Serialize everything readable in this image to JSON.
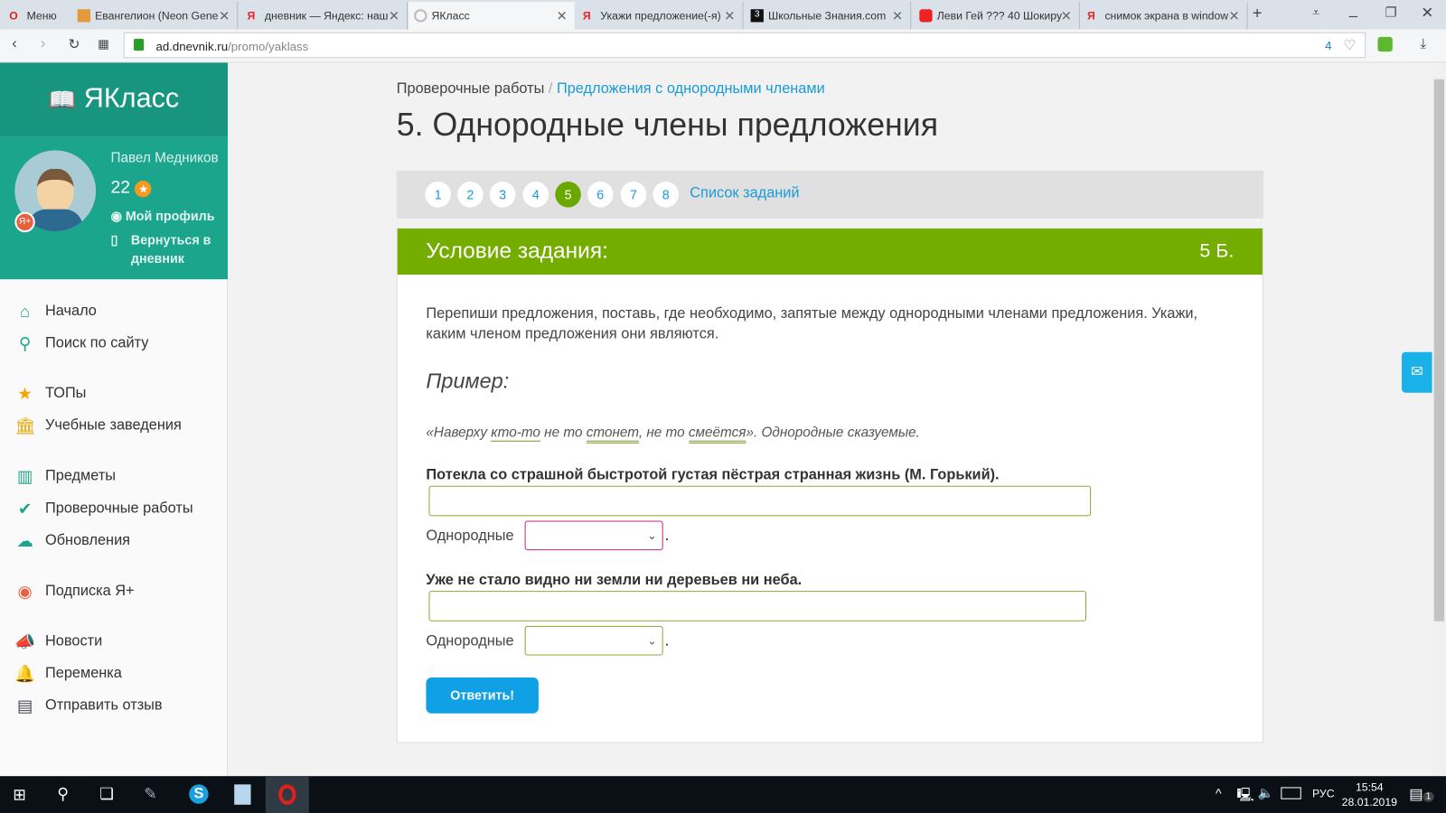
{
  "browser": {
    "tabs": [
      {
        "label": "Меню"
      },
      {
        "label": "Евангелион (Neon Gene"
      },
      {
        "label": "дневник — Яндекс: наш"
      },
      {
        "label": "ЯКласс"
      },
      {
        "label": "Укажи предложение(-я)"
      },
      {
        "label": "Школьные Знания.com"
      },
      {
        "label": "Леви Гей ??? 40 Шокиру"
      },
      {
        "label": "снимок экрана в window"
      }
    ],
    "url_host": "ad.dnevnik.ru",
    "url_path": "/promo/yaklass",
    "blocked_count": "4"
  },
  "sidebar": {
    "logo": "ЯКласс",
    "user_name": "Павел Медников",
    "points": "22",
    "my_profile": "Мой профиль",
    "back_to_diary": "Вернуться в дневник",
    "items": [
      {
        "label": "Начало",
        "icon": "home-icon"
      },
      {
        "label": "Поиск по сайту",
        "icon": "search-icon"
      },
      {
        "label": "ТОПы",
        "icon": "star-icon"
      },
      {
        "label": "Учебные заведения",
        "icon": "school-icon"
      },
      {
        "label": "Предметы",
        "icon": "books-icon"
      },
      {
        "label": "Проверочные работы",
        "icon": "check-icon"
      },
      {
        "label": "Обновления",
        "icon": "cloud-upload-icon"
      },
      {
        "label": "Подписка Я+",
        "icon": "yaplus-icon"
      },
      {
        "label": "Новости",
        "icon": "megaphone-icon"
      },
      {
        "label": "Переменка",
        "icon": "bell-icon"
      },
      {
        "label": "Отправить отзыв",
        "icon": "feedback-icon"
      }
    ]
  },
  "main": {
    "breadcrumb_root": "Проверочные работы",
    "breadcrumb_sep": "/",
    "breadcrumb_current": "Предложения с однородными членами",
    "title": "5. Однородные члены предложения",
    "pages": [
      "1",
      "2",
      "3",
      "4",
      "5",
      "6",
      "7",
      "8"
    ],
    "active_page": "5",
    "task_list": "Список заданий",
    "condition_title": "Условие задания:",
    "score": "5 Б.",
    "instruction": "Перепиши предложения, поставь, где необходимо, запятые между однородными членами предложения. Укажи, каким членом предложения они являются.",
    "example_title": "Пример:",
    "example": {
      "p1": "«Наверху ",
      "w1": "кто-то",
      "p2": " не то ",
      "w2": "стонет",
      "p3": ", не то ",
      "w3": "смеётся",
      "p4": "». Однородные сказуемые."
    },
    "q1": "Потекла со страшной быстротой густая пёстрая странная жизнь (М. Горький).",
    "q2": "Уже не стало видно ни земли ни деревьев ни неба.",
    "homog_label": "Однородные",
    "dot": ".",
    "submit": "Ответить!"
  },
  "taskbar": {
    "lang": "РУС",
    "time": "15:54",
    "date": "28.01.2019",
    "notif": "1"
  },
  "colors": {
    "brand": "#1aa58c",
    "accent_green": "#74ad00",
    "link": "#1a9bd7",
    "button": "#0fa0e6"
  }
}
